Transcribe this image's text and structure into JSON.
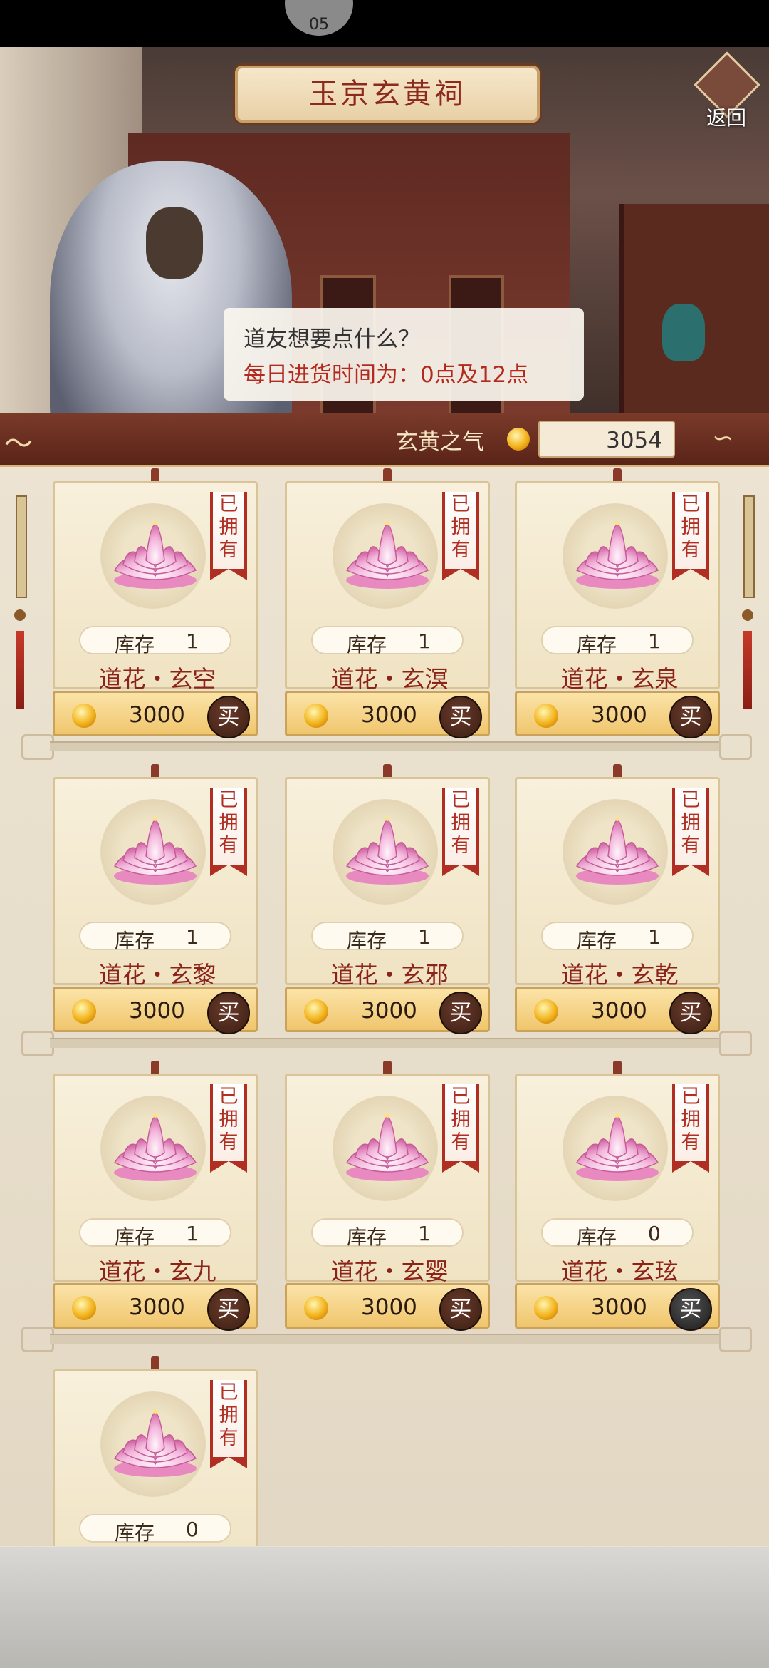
{
  "status": {
    "blob_text": "05"
  },
  "header": {
    "title": "玉京玄黄祠",
    "back_label": "返回"
  },
  "dialog": {
    "line1": "道友想要点什么？",
    "line2": "每日进货时间为：0点及12点"
  },
  "currency": {
    "label": "玄黄之气",
    "value": "3054",
    "icon": "fire-coin-icon"
  },
  "items": [
    {
      "badge": "已拥有",
      "stock_label": "库存",
      "stock": "1",
      "name": "道花・玄空",
      "price": "3000",
      "buy_label": "买",
      "enabled": true
    },
    {
      "badge": "已拥有",
      "stock_label": "库存",
      "stock": "1",
      "name": "道花・玄溟",
      "price": "3000",
      "buy_label": "买",
      "enabled": true
    },
    {
      "badge": "已拥有",
      "stock_label": "库存",
      "stock": "1",
      "name": "道花・玄泉",
      "price": "3000",
      "buy_label": "买",
      "enabled": true
    },
    {
      "badge": "已拥有",
      "stock_label": "库存",
      "stock": "1",
      "name": "道花・玄黎",
      "price": "3000",
      "buy_label": "买",
      "enabled": true
    },
    {
      "badge": "已拥有",
      "stock_label": "库存",
      "stock": "1",
      "name": "道花・玄邪",
      "price": "3000",
      "buy_label": "买",
      "enabled": true
    },
    {
      "badge": "已拥有",
      "stock_label": "库存",
      "stock": "1",
      "name": "道花・玄乾",
      "price": "3000",
      "buy_label": "买",
      "enabled": true
    },
    {
      "badge": "已拥有",
      "stock_label": "库存",
      "stock": "1",
      "name": "道花・玄九",
      "price": "3000",
      "buy_label": "买",
      "enabled": true
    },
    {
      "badge": "已拥有",
      "stock_label": "库存",
      "stock": "1",
      "name": "道花・玄婴",
      "price": "3000",
      "buy_label": "买",
      "enabled": true
    },
    {
      "badge": "已拥有",
      "stock_label": "库存",
      "stock": "0",
      "name": "道花・玄玹",
      "price": "3000",
      "buy_label": "买",
      "enabled": false
    },
    {
      "badge": "已拥有",
      "stock_label": "库存",
      "stock": "0",
      "name": "",
      "price": "",
      "buy_label": "",
      "enabled": false
    }
  ],
  "colors": {
    "accent_red": "#b02e22",
    "gold": "#f0c66d",
    "name_red": "#8b2318"
  }
}
